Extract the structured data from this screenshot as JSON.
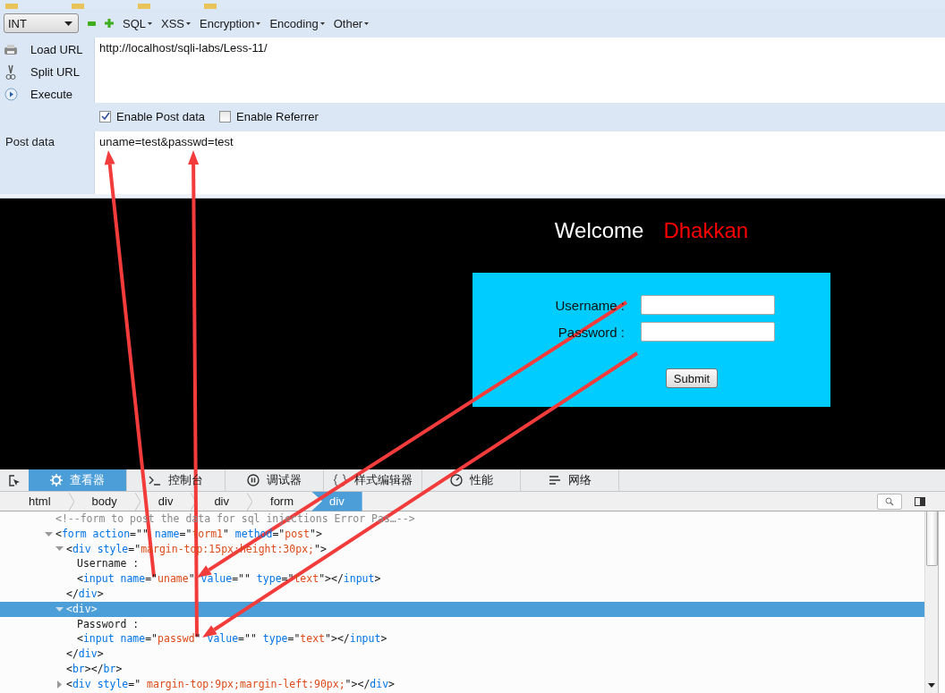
{
  "toolbar": {
    "mode": "INT",
    "menus": [
      "SQL",
      "XSS",
      "Encryption",
      "Encoding",
      "Other"
    ]
  },
  "actions": [
    {
      "kind": "load",
      "label": "Load URL"
    },
    {
      "kind": "split",
      "label": "Split URL"
    },
    {
      "kind": "execute",
      "label": "Execute"
    }
  ],
  "url": "http://localhost/sqli-labs/Less-11/",
  "options": [
    {
      "label": "Enable Post data",
      "checked": true
    },
    {
      "label": "Enable Referrer",
      "checked": false
    }
  ],
  "post_data": {
    "label": "Post data",
    "value": "uname=test&passwd=test"
  },
  "page": {
    "welcome": "Welcome",
    "name": "Dhakkan",
    "fields": [
      {
        "label": "Username :"
      },
      {
        "label": "Password :"
      }
    ],
    "submit": "Submit"
  },
  "devtools": {
    "tabs": [
      {
        "label": "查看器",
        "selected": true
      },
      {
        "label": "控制台",
        "selected": false
      },
      {
        "label": "调试器",
        "selected": false
      },
      {
        "label": "样式编辑器",
        "selected": false
      },
      {
        "label": "性能",
        "selected": false
      },
      {
        "label": "网络",
        "selected": false
      }
    ],
    "breadcrumbs": [
      {
        "label": "html",
        "selected": false
      },
      {
        "label": "body",
        "selected": false
      },
      {
        "label": "div",
        "selected": false
      },
      {
        "label": "div",
        "selected": false
      },
      {
        "label": "form",
        "selected": false
      },
      {
        "label": "div",
        "selected": true
      }
    ],
    "tree": [
      {
        "line": [
          {
            "kind": "comment",
            "text": "<!--form to post the data for sql injections Error Pas…-->"
          }
        ],
        "selected": false
      },
      {
        "line": [
          {
            "kind": "punct",
            "text": "<"
          },
          {
            "kind": "tag",
            "text": "form"
          },
          {
            "kind": "attr",
            "text": " action"
          },
          {
            "kind": "punct",
            "text": "=\"\""
          },
          {
            "kind": "attr",
            "text": " name"
          },
          {
            "kind": "punct",
            "text": "=\""
          },
          {
            "kind": "value",
            "text": "form1"
          },
          {
            "kind": "punct",
            "text": "\""
          },
          {
            "kind": "attr",
            "text": " method"
          },
          {
            "kind": "punct",
            "text": "=\""
          },
          {
            "kind": "value",
            "text": "post"
          },
          {
            "kind": "punct",
            "text": "\">"
          }
        ],
        "expanded": true,
        "selected": false,
        "children": [
          {
            "line": [
              {
                "kind": "punct",
                "text": "<"
              },
              {
                "kind": "tag",
                "text": "div"
              },
              {
                "kind": "attr",
                "text": " style"
              },
              {
                "kind": "punct",
                "text": "=\""
              },
              {
                "kind": "value",
                "text": "margin-top:15px;height:30px;"
              },
              {
                "kind": "punct",
                "text": "\">"
              }
            ],
            "expanded": true,
            "selected": false,
            "close": [
              {
                "kind": "punct",
                "text": "</"
              },
              {
                "kind": "tag",
                "text": "div"
              },
              {
                "kind": "punct",
                "text": ">"
              }
            ],
            "children": [
              {
                "line": [
                  {
                    "kind": "text",
                    "text": "Username :"
                  }
                ],
                "selected": false
              },
              {
                "line": [
                  {
                    "kind": "punct",
                    "text": "<"
                  },
                  {
                    "kind": "tag",
                    "text": "input"
                  },
                  {
                    "kind": "attr",
                    "text": " name"
                  },
                  {
                    "kind": "punct",
                    "text": "=\""
                  },
                  {
                    "kind": "value",
                    "text": "uname"
                  },
                  {
                    "kind": "punct",
                    "text": "\""
                  },
                  {
                    "kind": "attr",
                    "text": " value"
                  },
                  {
                    "kind": "punct",
                    "text": "=\"\""
                  },
                  {
                    "kind": "attr",
                    "text": " type"
                  },
                  {
                    "kind": "punct",
                    "text": "=\""
                  },
                  {
                    "kind": "value",
                    "text": "text"
                  },
                  {
                    "kind": "punct",
                    "text": "\"></"
                  },
                  {
                    "kind": "tag",
                    "text": "input"
                  },
                  {
                    "kind": "punct",
                    "text": ">"
                  }
                ],
                "selected": false
              }
            ]
          },
          {
            "line": [
              {
                "kind": "punct",
                "text": "<"
              },
              {
                "kind": "tag",
                "text": "div"
              },
              {
                "kind": "punct",
                "text": ">"
              }
            ],
            "expanded": true,
            "selected": true,
            "close": [
              {
                "kind": "punct",
                "text": "</"
              },
              {
                "kind": "tag",
                "text": "div"
              },
              {
                "kind": "punct",
                "text": ">"
              }
            ],
            "children": [
              {
                "line": [
                  {
                    "kind": "text",
                    "text": "Password :"
                  }
                ],
                "selected": false
              },
              {
                "line": [
                  {
                    "kind": "punct",
                    "text": "<"
                  },
                  {
                    "kind": "tag",
                    "text": "input"
                  },
                  {
                    "kind": "attr",
                    "text": " name"
                  },
                  {
                    "kind": "punct",
                    "text": "=\""
                  },
                  {
                    "kind": "value",
                    "text": "passwd"
                  },
                  {
                    "kind": "punct",
                    "text": "\""
                  },
                  {
                    "kind": "attr",
                    "text": " value"
                  },
                  {
                    "kind": "punct",
                    "text": "=\"\""
                  },
                  {
                    "kind": "attr",
                    "text": " type"
                  },
                  {
                    "kind": "punct",
                    "text": "=\""
                  },
                  {
                    "kind": "value",
                    "text": "text"
                  },
                  {
                    "kind": "punct",
                    "text": "\"></"
                  },
                  {
                    "kind": "tag",
                    "text": "input"
                  },
                  {
                    "kind": "punct",
                    "text": ">"
                  }
                ],
                "selected": false
              }
            ]
          },
          {
            "line": [
              {
                "kind": "punct",
                "text": "<"
              },
              {
                "kind": "tag",
                "text": "br"
              },
              {
                "kind": "punct",
                "text": "></"
              },
              {
                "kind": "tag",
                "text": "br"
              },
              {
                "kind": "punct",
                "text": ">"
              }
            ],
            "selected": false
          },
          {
            "line": [
              {
                "kind": "punct",
                "text": "<"
              },
              {
                "kind": "tag",
                "text": "div"
              },
              {
                "kind": "attr",
                "text": " style"
              },
              {
                "kind": "punct",
                "text": "=\""
              },
              {
                "kind": "value",
                "text": " margin-top:9px;margin-left:90px;"
              },
              {
                "kind": "punct",
                "text": "\"></"
              },
              {
                "kind": "tag",
                "text": "div"
              },
              {
                "kind": "punct",
                "text": ">"
              }
            ],
            "expanded": false,
            "selected": false
          }
        ]
      }
    ]
  }
}
